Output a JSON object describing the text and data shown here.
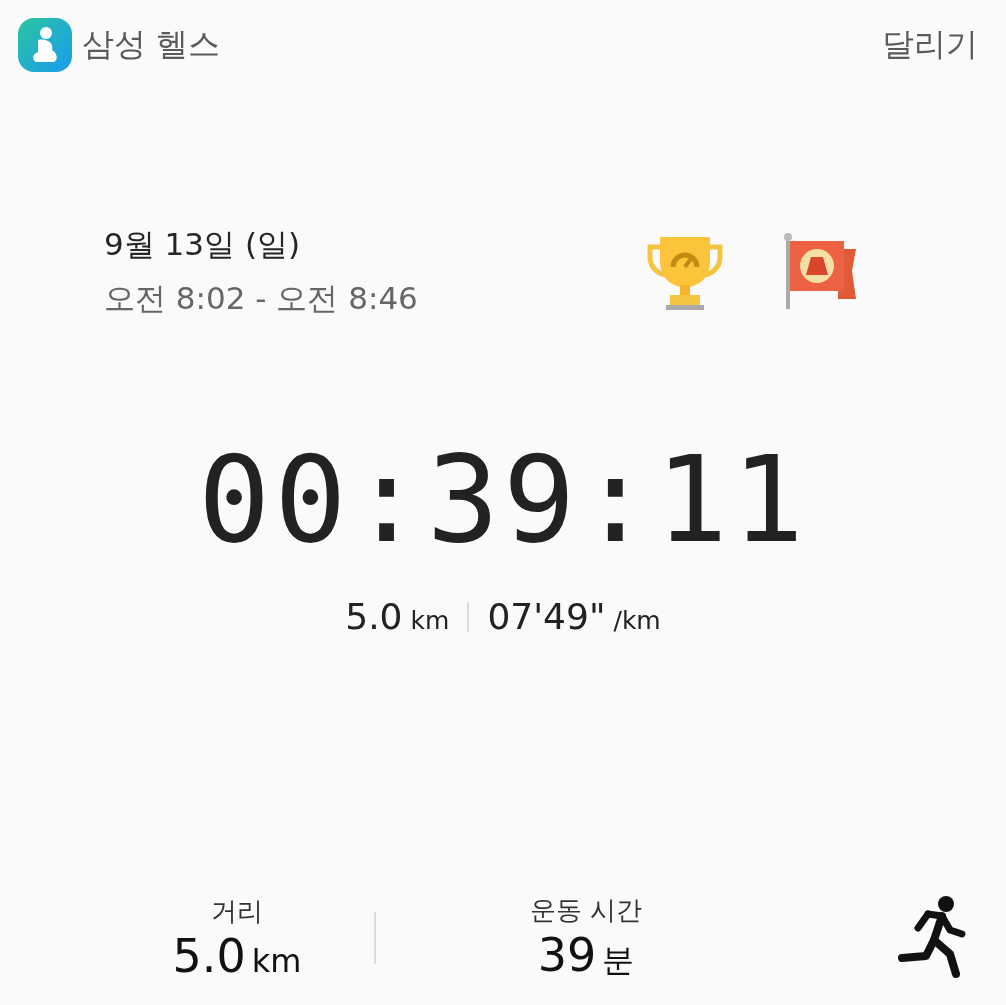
{
  "header": {
    "app_name": "삼성 헬스",
    "activity": "달리기"
  },
  "session": {
    "date": "9월 13일 (일)",
    "time_range": "오전 8:02 - 오전 8:46"
  },
  "timer": "00:39:11",
  "summary": [
    {
      "value": "5.0",
      "unit": "km"
    },
    {
      "value": "07'49\"",
      "unit": "/km"
    }
  ],
  "stats": [
    {
      "label": "거리",
      "value": "5.0",
      "unit": "km"
    },
    {
      "label": "운동 시간",
      "value": "39",
      "unit": "분"
    }
  ]
}
